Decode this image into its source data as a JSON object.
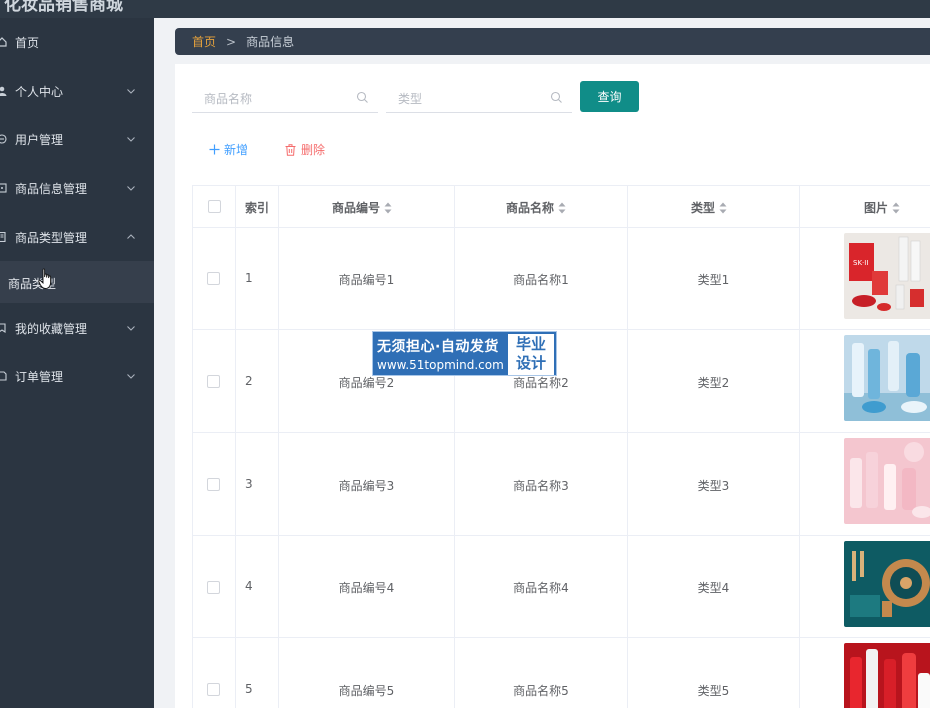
{
  "app": {
    "title": "化妆品销售商城"
  },
  "colors": {
    "sidebar_bg": "#2b3541",
    "accent_teal": "#108d88",
    "breadcrumb_home": "#e6a23c",
    "add_blue": "#409eff",
    "delete_red": "#f56c6c"
  },
  "sidebar": {
    "items": [
      {
        "label": "首页",
        "icon": "home-icon"
      },
      {
        "label": "个人中心",
        "icon": "user-icon"
      },
      {
        "label": "用户管理",
        "icon": "users-icon"
      },
      {
        "label": "商品信息管理",
        "icon": "product-icon"
      },
      {
        "label": "商品类型管理",
        "icon": "category-icon"
      },
      {
        "label": "我的收藏管理",
        "icon": "favorite-icon"
      },
      {
        "label": "订单管理",
        "icon": "order-icon"
      }
    ],
    "sub_item": {
      "label": "商品类型"
    }
  },
  "breadcrumb": {
    "home": "首页",
    "separator": ">",
    "current": "商品信息"
  },
  "search": {
    "name_placeholder": "商品名称",
    "type_placeholder": "类型",
    "query_label": "查询"
  },
  "actions": {
    "add_label": "新增",
    "delete_label": "删除"
  },
  "table": {
    "headers": [
      "索引",
      "商品编号",
      "商品名称",
      "类型",
      "图片"
    ],
    "rows": [
      {
        "index": "1",
        "code": "商品编号1",
        "name": "商品名称1",
        "type": "类型1",
        "image": "skincare-product-photo"
      },
      {
        "index": "2",
        "code": "商品编号2",
        "name": "商品名称2",
        "type": "类型2",
        "image": "blue-skincare-photo"
      },
      {
        "index": "3",
        "code": "商品编号3",
        "name": "商品名称3",
        "type": "类型3",
        "image": "pink-skincare-photo"
      },
      {
        "index": "4",
        "code": "商品编号4",
        "name": "商品名称4",
        "type": "类型4",
        "image": "teal-cosmetics-photo"
      },
      {
        "index": "5",
        "code": "商品编号5",
        "name": "商品名称5",
        "type": "类型5",
        "image": "red-skincare-photo"
      }
    ]
  },
  "watermark": {
    "line1": "无须担心·自动发货",
    "line2": "www.51topmind.com",
    "right_line1": "毕业",
    "right_line2": "设计"
  }
}
